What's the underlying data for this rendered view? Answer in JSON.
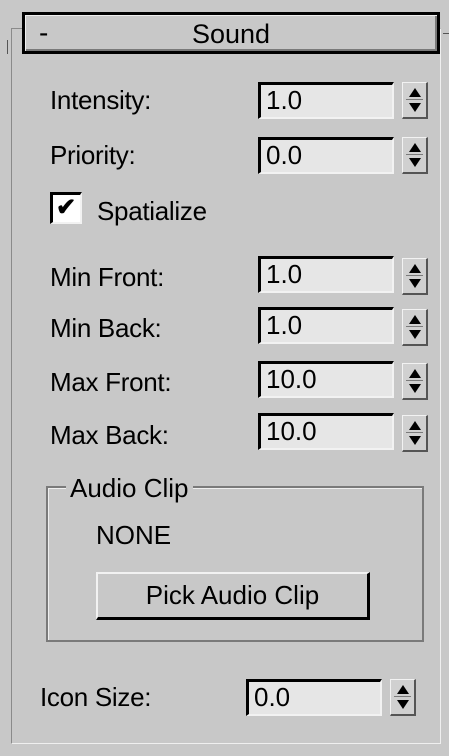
{
  "header": {
    "collapse_symbol": "-",
    "title": "Sound"
  },
  "fields": [
    {
      "label": "Intensity:",
      "value": "1.0"
    },
    {
      "label": "Priority:",
      "value": "0.0"
    },
    {
      "label": "Min Front:",
      "value": "1.0"
    },
    {
      "label": "Min Back:",
      "value": "1.0"
    },
    {
      "label": "Max Front:",
      "value": "10.0"
    },
    {
      "label": "Max Back:",
      "value": "10.0"
    },
    {
      "label": "Icon Size:",
      "value": "0.0"
    }
  ],
  "spatialize": {
    "label": "Spatialize",
    "checked": true,
    "checkmark": "✔"
  },
  "audio_clip": {
    "group_label": "Audio Clip",
    "current": "NONE",
    "pick_button": "Pick Audio Clip"
  },
  "icons": {
    "spinner": "up-down-spinner-icon",
    "check": "check-icon"
  }
}
